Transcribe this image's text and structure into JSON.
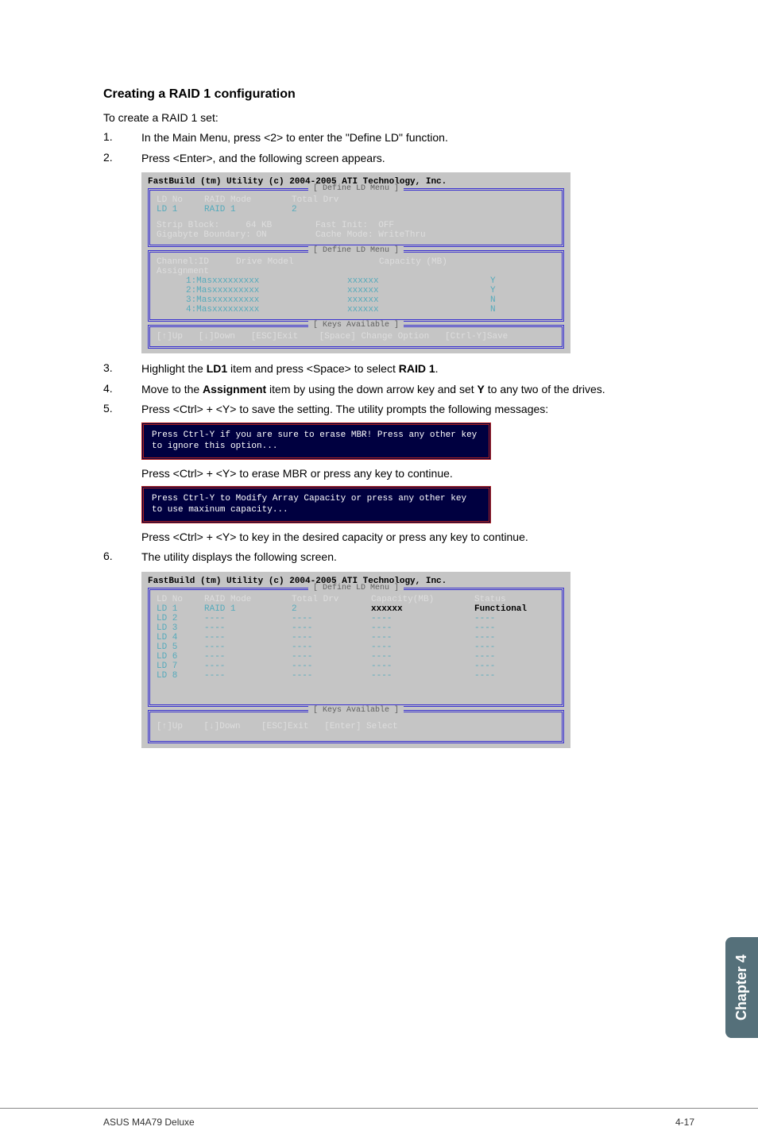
{
  "heading": "Creating a RAID 1 configuration",
  "intro": "To create a RAID 1 set:",
  "steps": {
    "s1": {
      "num": "1.",
      "text_a": "In the Main Menu, press <2> to enter the \"Define LD\" function."
    },
    "s2": {
      "num": "2.",
      "text_a": "Press <Enter>, and the following screen appears."
    },
    "s3": {
      "num": "3.",
      "text_pre": "Highlight the ",
      "bold1": "LD1",
      "text_mid": " item and press <Space> to select ",
      "bold2": "RAID 1",
      "text_post": "."
    },
    "s4": {
      "num": "4.",
      "text_pre": "Move to the ",
      "bold1": "Assignment",
      "text_mid": " item by using the down arrow key and set ",
      "bold2": "Y",
      "text_post": " to any two of the drives."
    },
    "s5": {
      "num": "5.",
      "text_a": "Press <Ctrl> + <Y> to save the setting. The utility prompts the following messages:"
    },
    "s5a": "Press <Ctrl> + <Y> to erase MBR or press any key to continue.",
    "s5b": "Press <Ctrl> + <Y> to key in the desired capacity or press any key to continue.",
    "s6": {
      "num": "6.",
      "text_a": "The utility displays the following screen."
    }
  },
  "bios1": {
    "title": "FastBuild (tm) Utility (c) 2004-2005 ATI Technology, Inc.",
    "section1_label": "[ Define LD Menu ]",
    "headers": {
      "ldno": "LD No",
      "mode": "RAID Mode",
      "drv": "Total Drv"
    },
    "row_ld": {
      "ldno": "LD 1",
      "mode": "RAID 1",
      "drv": "2"
    },
    "strip_lbl": "Strip Block:",
    "strip_val": "64 KB",
    "fast_lbl": "Fast Init:",
    "fast_val": "OFF",
    "giga_lbl": "Gigabyte Boundary:",
    "giga_val": "ON",
    "cache_lbl": "Cache Mode:",
    "cache_val": "WriteThru",
    "section2_label": "[ Define LD Menu ]",
    "ch_hdr": {
      "id": "Channel:ID",
      "model": "Drive Model",
      "cap": "Capacity (MB)"
    },
    "assign": "Assignment",
    "rows": [
      {
        "id": "1:Mas",
        "model": "xxxxxxxxx",
        "cap": "xxxxxx",
        "a": "Y"
      },
      {
        "id": "2:Mas",
        "model": "xxxxxxxxx",
        "cap": "xxxxxx",
        "a": "Y"
      },
      {
        "id": "3:Mas",
        "model": "xxxxxxxxx",
        "cap": "xxxxxx",
        "a": "N"
      },
      {
        "id": "4:Mas",
        "model": "xxxxxxxxx",
        "cap": "xxxxxx",
        "a": "N"
      }
    ],
    "keys_label": "[ Keys Available ]",
    "keys": "[↑]Up   [↓]Down   [ESC]Exit    [Space] Change Option   [Ctrl-Y]Save"
  },
  "msg1": "Press Ctrl-Y if you are sure to erase MBR! Press any other key to ignore this option...",
  "msg2": "Press Ctrl-Y to Modify Array Capacity or press any other key to use maxinum capacity...",
  "bios2": {
    "title": "FastBuild (tm) Utility (c) 2004-2005 ATI Technology, Inc.",
    "section_label": "[ Define LD Menu ]",
    "headers": {
      "ldno": "LD No",
      "mode": "RAID Mode",
      "drv": "Total Drv",
      "cap": "Capacity(MB)",
      "stat": "Status"
    },
    "row1": {
      "ldno": "LD 1",
      "mode": "RAID 1",
      "drv": "2",
      "cap": "xxxxxx",
      "stat": "Functional"
    },
    "rows": [
      {
        "ldno": "LD 2"
      },
      {
        "ldno": "LD 3"
      },
      {
        "ldno": "LD 4"
      },
      {
        "ldno": "LD 5"
      },
      {
        "ldno": "LD 6"
      },
      {
        "ldno": "LD 7"
      },
      {
        "ldno": "LD 8"
      }
    ],
    "dash": "----",
    "keys_label": "[ Keys Available ]",
    "keys": "[↑]Up    [↓]Down    [ESC]Exit   [Enter] Select"
  },
  "side_tab": "Chapter 4",
  "footer_left": "ASUS M4A79 Deluxe",
  "footer_right": "4-17"
}
